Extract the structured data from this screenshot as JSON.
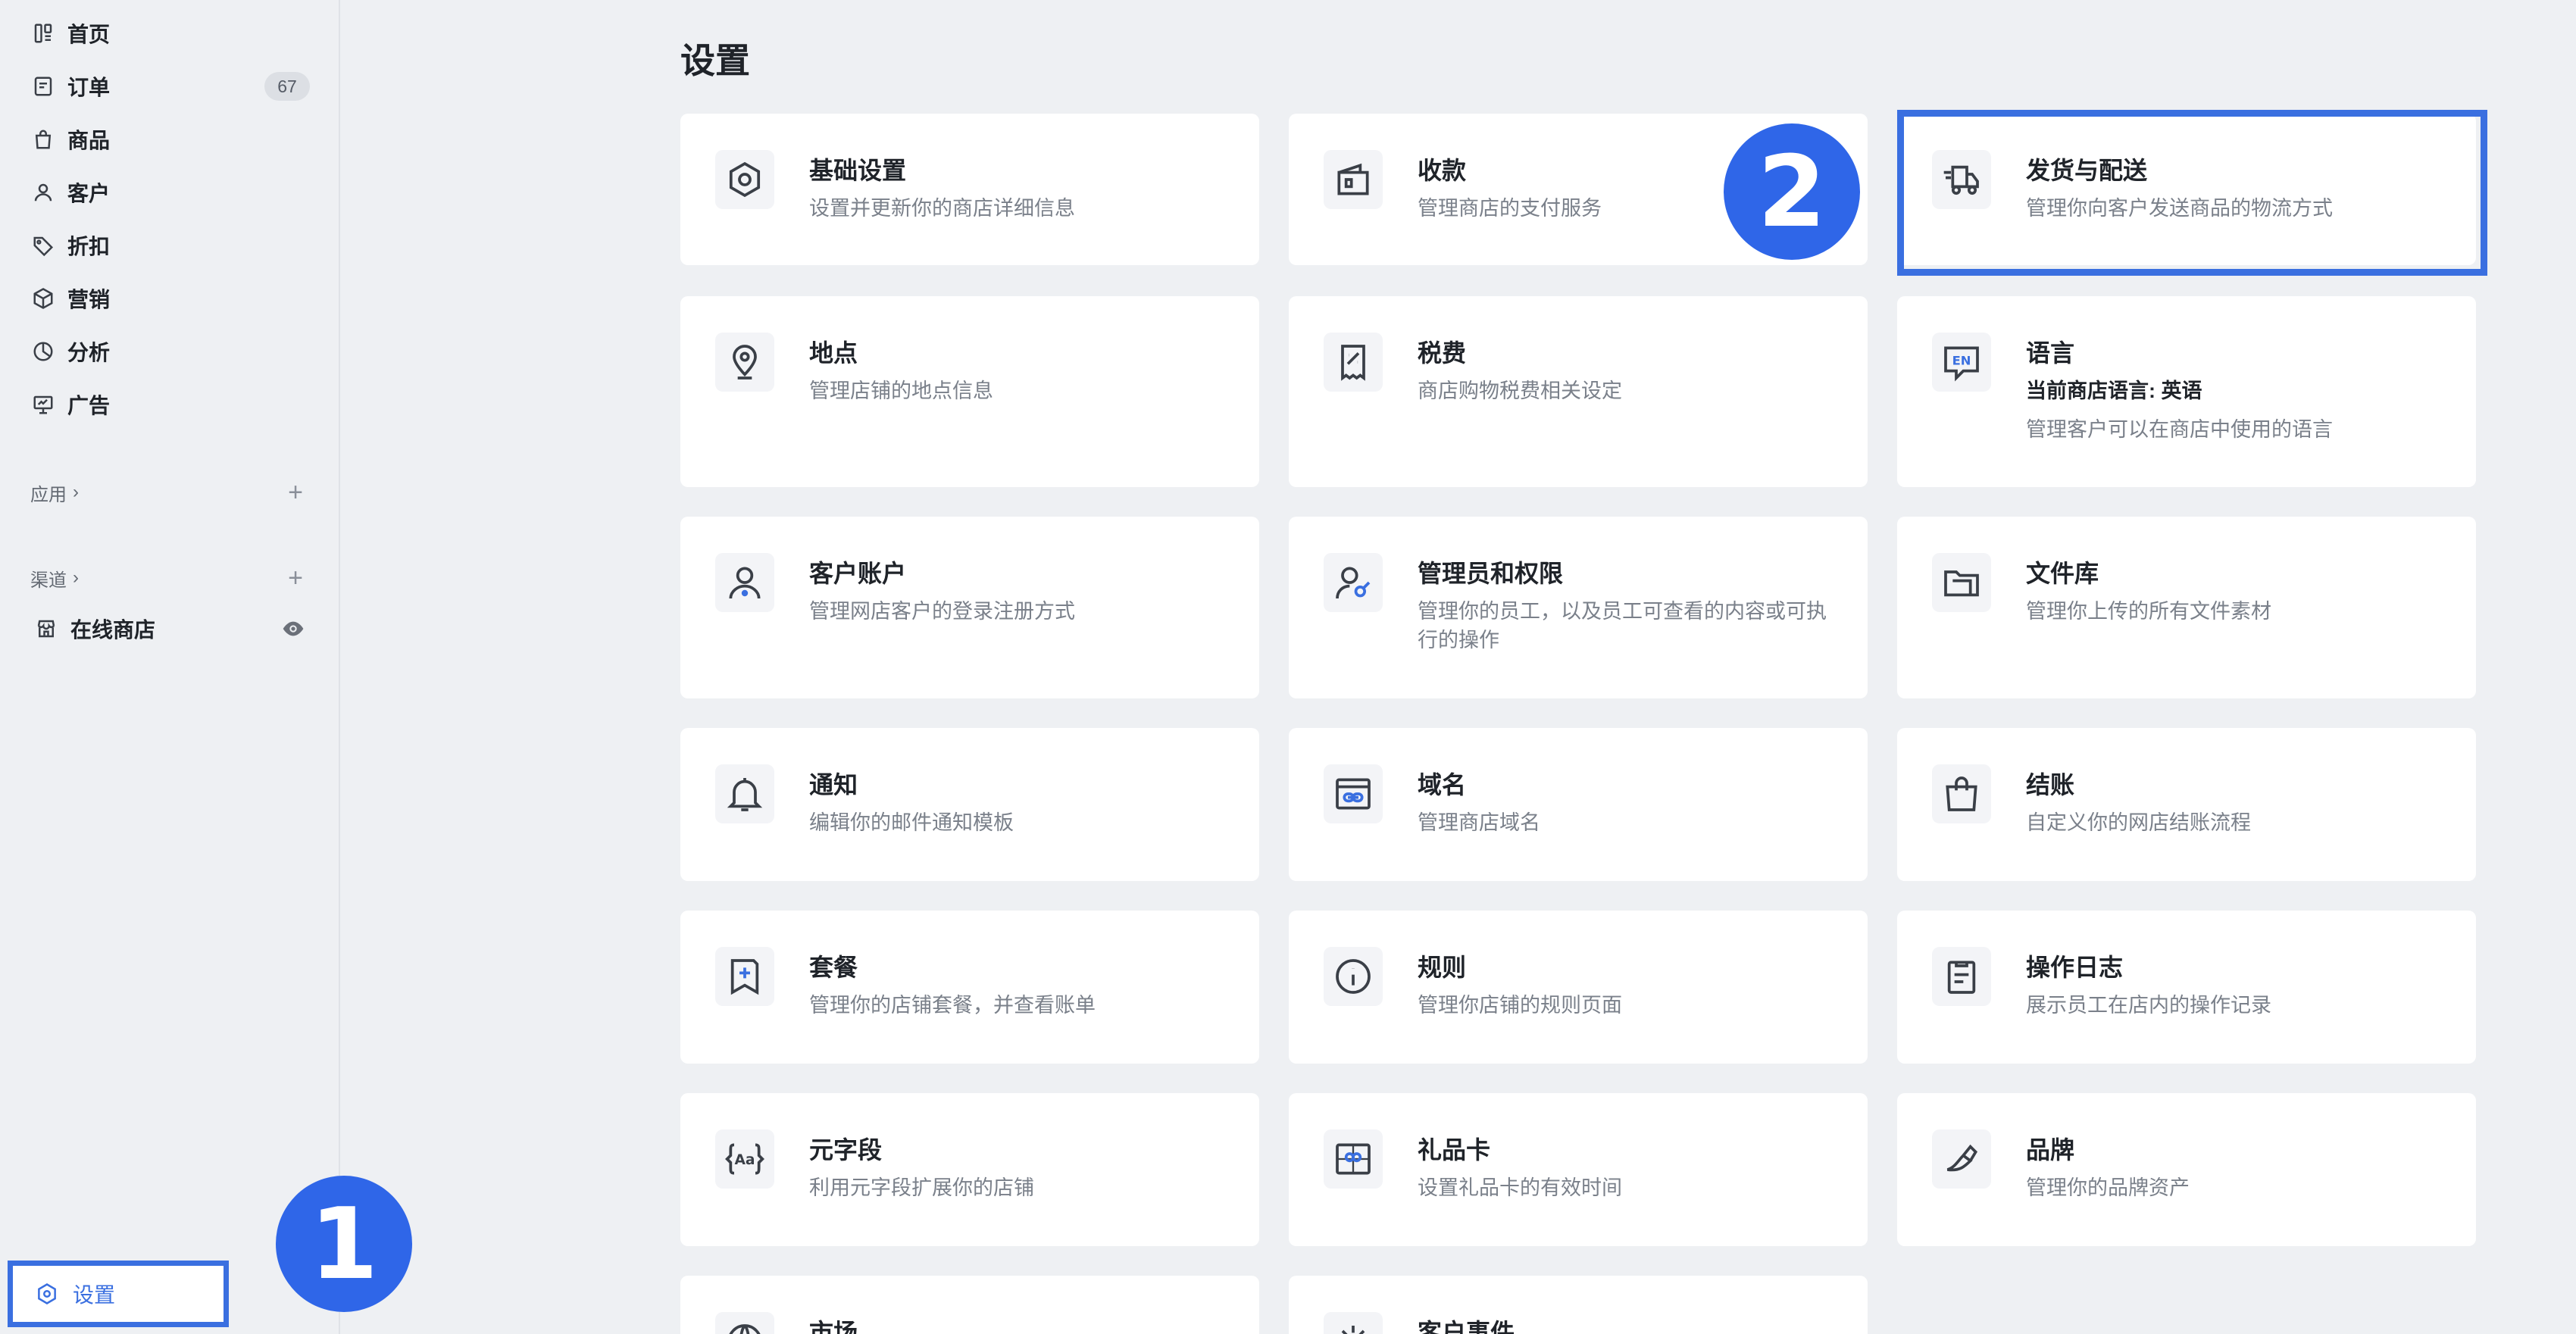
{
  "sidebar": {
    "items": [
      {
        "label": "首页",
        "icon": "home-icon"
      },
      {
        "label": "订单",
        "icon": "orders-icon",
        "badge": "67"
      },
      {
        "label": "商品",
        "icon": "products-bag-icon"
      },
      {
        "label": "客户",
        "icon": "customer-icon"
      },
      {
        "label": "折扣",
        "icon": "tag-icon"
      },
      {
        "label": "营销",
        "icon": "cube-icon"
      },
      {
        "label": "分析",
        "icon": "pie-chart-icon"
      },
      {
        "label": "广告",
        "icon": "ad-monitor-icon"
      }
    ],
    "apps_label": "应用",
    "channels_label": "渠道",
    "online_store_label": "在线商店",
    "settings_label": "设置"
  },
  "annotations": {
    "step1": "1",
    "step2": "2"
  },
  "main": {
    "title": "设置",
    "cards": [
      {
        "title": "基础设置",
        "desc": "设置并更新你的商店详细信息",
        "icon": "gear-icon"
      },
      {
        "title": "收款",
        "desc": "管理商店的支付服务",
        "icon": "wallet-icon"
      },
      {
        "title": "发货与配送",
        "desc": "管理你向客户发送商品的物流方式",
        "icon": "delivery-truck-icon"
      },
      {
        "title": "地点",
        "desc": "管理店铺的地点信息",
        "icon": "location-pin-icon"
      },
      {
        "title": "税费",
        "desc": "商店购物税费相关设定",
        "icon": "tax-receipt-icon"
      },
      {
        "title": "语言",
        "sub": "当前商店语言: 英语",
        "desc": "管理客户可以在商店中使用的语言",
        "icon": "language-en-icon"
      },
      {
        "title": "客户账户",
        "desc": "管理网店客户的登录注册方式",
        "icon": "customer-account-icon"
      },
      {
        "title": "管理员和权限",
        "desc": "管理你的员工，以及员工可查看的内容或可执行的操作",
        "icon": "admin-key-icon"
      },
      {
        "title": "文件库",
        "desc": "管理你上传的所有文件素材",
        "icon": "folder-icon"
      },
      {
        "title": "通知",
        "desc": "编辑你的邮件通知模板",
        "icon": "bell-icon"
      },
      {
        "title": "域名",
        "desc": "管理商店域名",
        "icon": "domain-link-icon"
      },
      {
        "title": "结账",
        "desc": "自定义你的网店结账流程",
        "icon": "shopping-bag-icon"
      },
      {
        "title": "套餐",
        "desc": "管理你的店铺套餐，并查看账单",
        "icon": "plan-bookmark-icon"
      },
      {
        "title": "规则",
        "desc": "管理你店铺的规则页面",
        "icon": "info-icon"
      },
      {
        "title": "操作日志",
        "desc": "展示员工在店内的操作记录",
        "icon": "log-clipboard-icon"
      },
      {
        "title": "元字段",
        "desc": "利用元字段扩展你的店铺",
        "icon": "metafield-braces-icon"
      },
      {
        "title": "礼品卡",
        "desc": "设置礼品卡的有效时间",
        "icon": "gift-card-icon"
      },
      {
        "title": "品牌",
        "desc": "管理你的品牌资产",
        "icon": "brand-brush-icon"
      },
      {
        "title": "市场",
        "desc": "",
        "icon": "globe-icon"
      },
      {
        "title": "客户事件",
        "desc": "",
        "icon": "spark-icon"
      }
    ]
  },
  "colors": {
    "accent": "#3a6fe0",
    "step": "#2f66e8",
    "bg": "#eef0f3"
  }
}
